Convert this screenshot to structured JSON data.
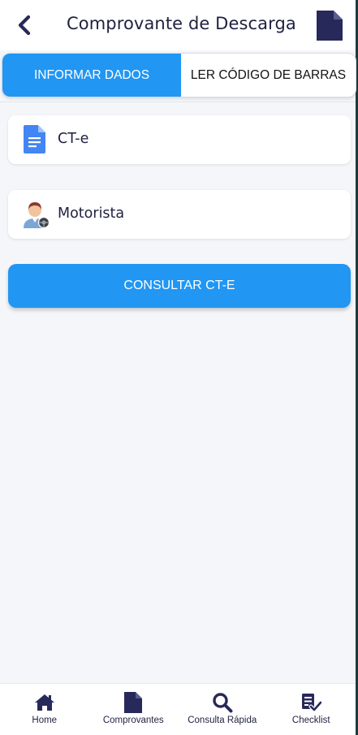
{
  "header": {
    "title": "Comprovante de Descarga",
    "back_icon": "chevron-left-icon",
    "action_icon": "document-icon"
  },
  "tabs": [
    {
      "label": "INFORMAR DADOS",
      "active": true
    },
    {
      "label": "LER CÓDIGO DE BARRAS",
      "active": false
    }
  ],
  "fields": [
    {
      "label": "CT-e",
      "icon": "document-blue-icon"
    },
    {
      "label": "Motorista",
      "icon": "driver-avatar-icon"
    }
  ],
  "consult_button": {
    "label": "CONSULTAR CT-E"
  },
  "bottom_nav": [
    {
      "label": "Home",
      "icon": "home-icon"
    },
    {
      "label": "Comprovantes",
      "icon": "document-icon"
    },
    {
      "label": "Consulta Rápida",
      "icon": "search-icon"
    },
    {
      "label": "Checklist",
      "icon": "checklist-icon"
    }
  ],
  "colors": {
    "accent": "#2196f3",
    "dark_navy": "#27295a",
    "background": "#f4f6fa"
  }
}
